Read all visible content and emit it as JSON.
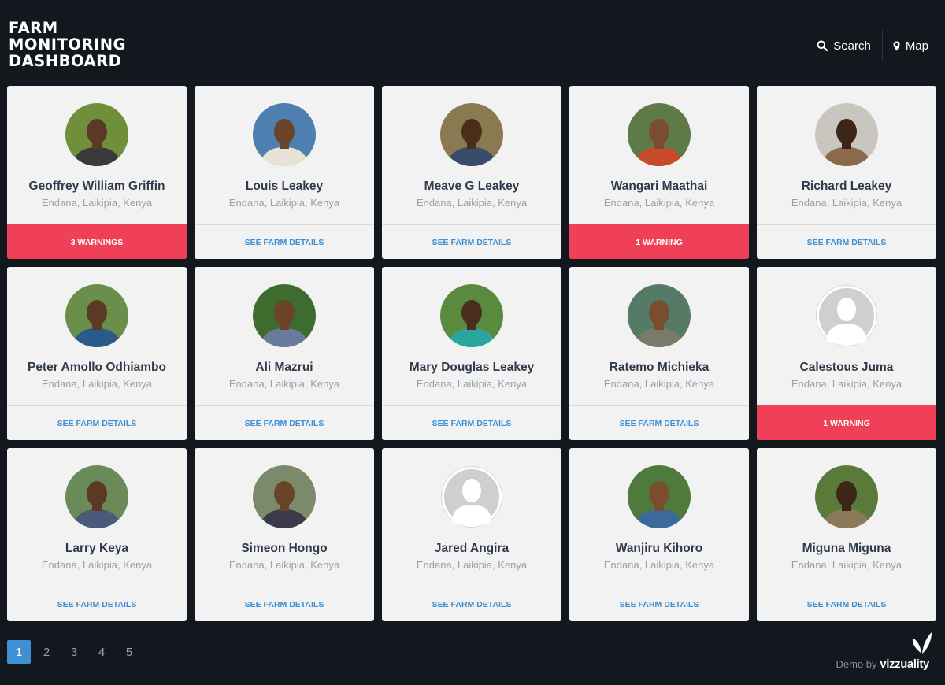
{
  "app": {
    "title": "FARM\nMONITORING\nDASHBOARD"
  },
  "nav": {
    "search_label": "Search",
    "search_icon": "search-icon",
    "map_label": "Map",
    "map_icon": "map-pin-icon"
  },
  "colors": {
    "background": "#13171e",
    "card": "#f2f2f2",
    "warning": "#ef4057",
    "link": "#3f8fd3",
    "name": "#2f3b4c"
  },
  "farmers": [
    {
      "name": "Geoffrey William Griffin",
      "location": "Endana, Laikipia, Kenya",
      "action": "3 WARNINGS",
      "warning": true,
      "photo": true
    },
    {
      "name": "Louis Leakey",
      "location": "Endana, Laikipia, Kenya",
      "action": "SEE FARM DETAILS",
      "warning": false,
      "photo": true
    },
    {
      "name": "Meave G Leakey",
      "location": "Endana, Laikipia, Kenya",
      "action": "SEE FARM DETAILS",
      "warning": false,
      "photo": true
    },
    {
      "name": "Wangari Maathai",
      "location": "Endana, Laikipia, Kenya",
      "action": "1 WARNING",
      "warning": true,
      "photo": true
    },
    {
      "name": "Richard Leakey",
      "location": "Endana, Laikipia, Kenya",
      "action": "SEE FARM DETAILS",
      "warning": false,
      "photo": true
    },
    {
      "name": "Peter Amollo Odhiambo",
      "location": "Endana, Laikipia, Kenya",
      "action": "SEE FARM DETAILS",
      "warning": false,
      "photo": true
    },
    {
      "name": "Ali Mazrui",
      "location": "Endana, Laikipia, Kenya",
      "action": "SEE FARM DETAILS",
      "warning": false,
      "photo": true
    },
    {
      "name": "Mary Douglas Leakey",
      "location": "Endana, Laikipia, Kenya",
      "action": "SEE FARM DETAILS",
      "warning": false,
      "photo": true
    },
    {
      "name": "Ratemo Michieka",
      "location": "Endana, Laikipia, Kenya",
      "action": "SEE FARM DETAILS",
      "warning": false,
      "photo": true
    },
    {
      "name": "Calestous Juma",
      "location": "Endana, Laikipia, Kenya",
      "action": "1 WARNING",
      "warning": true,
      "photo": false
    },
    {
      "name": "Larry Keya",
      "location": "Endana, Laikipia, Kenya",
      "action": "SEE FARM DETAILS",
      "warning": false,
      "photo": true
    },
    {
      "name": "Simeon Hongo",
      "location": "Endana, Laikipia, Kenya",
      "action": "SEE FARM DETAILS",
      "warning": false,
      "photo": true
    },
    {
      "name": "Jared Angira",
      "location": "Endana, Laikipia, Kenya",
      "action": "SEE FARM DETAILS",
      "warning": false,
      "photo": false
    },
    {
      "name": "Wanjiru Kihoro",
      "location": "Endana, Laikipia, Kenya",
      "action": "SEE FARM DETAILS",
      "warning": false,
      "photo": true
    },
    {
      "name": "Miguna Miguna",
      "location": "Endana, Laikipia, Kenya",
      "action": "SEE FARM DETAILS",
      "warning": false,
      "photo": true
    }
  ],
  "pagination": {
    "pages": [
      "1",
      "2",
      "3",
      "4",
      "5"
    ],
    "current": "1"
  },
  "footer": {
    "credit_label": "Demo by",
    "brand": "vizzuality"
  }
}
